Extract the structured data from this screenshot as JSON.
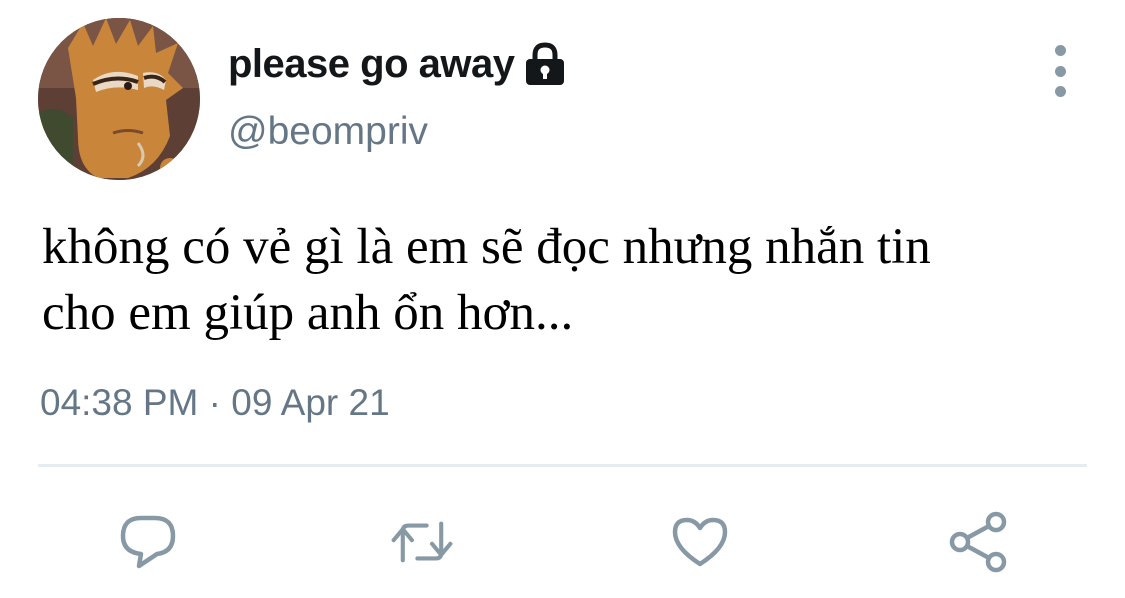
{
  "user": {
    "display_name": "please go away",
    "handle": "@beompriv",
    "protected": true
  },
  "tweet": {
    "text_line_1": "không có vẻ gì là em sẽ đọc nhưng nhắn tin",
    "text_line_2": "cho em giúp anh ổn hơn...",
    "time": "04:38 PM",
    "separator": "·",
    "date": "09 Apr 21"
  },
  "icons": {
    "lock": "lock-icon",
    "more": "more-vertical-icon",
    "reply": "reply-icon",
    "retweet": "retweet-icon",
    "like": "heart-icon",
    "share": "share-icon"
  },
  "colors": {
    "text_primary": "#14171a",
    "text_secondary": "#657786",
    "icon_gray": "#8899a6",
    "divider": "#e6ecf0"
  }
}
